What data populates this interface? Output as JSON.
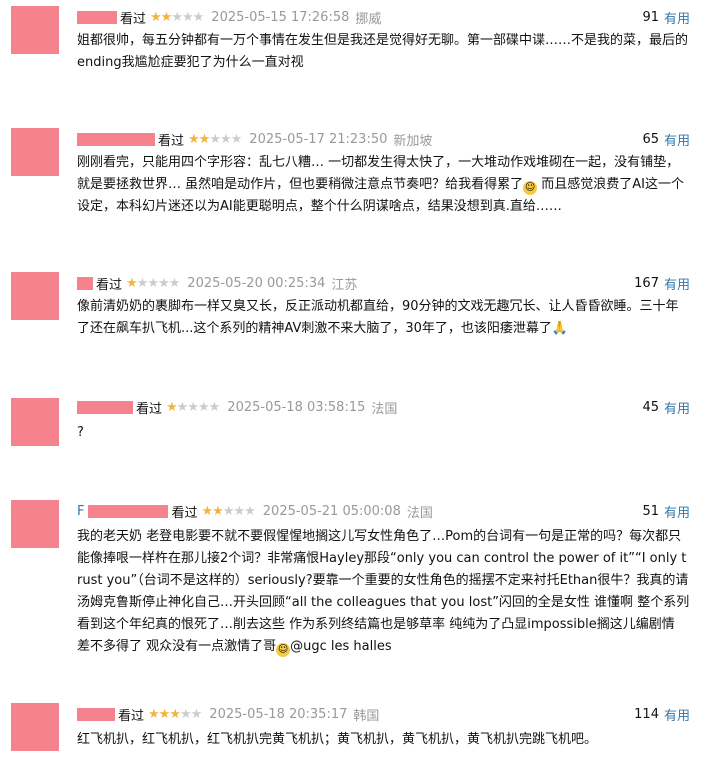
{
  "reviews": [
    {
      "seen_label": "看过",
      "stars": 2,
      "time": "2025-05-15 17:26:58",
      "location": "挪威",
      "useful_count": "91",
      "useful_label": "有用",
      "content": "姐都很帅，每五分钟都有一万个事情在发生但是我还是觉得好无聊。第一部碟中谍……不是我的菜，最后的ending我尴尬症要犯了为什么一直对视"
    },
    {
      "seen_label": "看过",
      "stars": 2,
      "time": "2025-05-17 21:23:50",
      "location": "新加坡",
      "useful_count": "65",
      "useful_label": "有用",
      "content": "刚刚看完，只能用四个字形容：乱七八糟… 一切都发生得太快了，一大堆动作戏堆砌在一起，没有铺垫，就是要拯救世界… 虽然咱是动作片，但也要稍微注意点节奏吧？给我看得累了",
      "content_after": " 而且感觉浪费了AI这一个设定，本科幻片迷还以为AI能更聪明点，整个什么阴谋啥点，结果没想到真.直给……"
    },
    {
      "seen_label": "看过",
      "stars": 1,
      "time": "2025-05-20 00:25:34",
      "location": "江苏",
      "useful_count": "167",
      "useful_label": "有用",
      "content": "像前清奶奶的裹脚布一样又臭又长，反正派动机都直给，90分钟的文戏无趣冗长、让人昏昏欲睡。三十年了还在飙车扒飞机...这个系列的精神AV刺激不来大脑了，30年了，也该阳痿泄幕了",
      "emoji_end": "🙏"
    },
    {
      "seen_label": "看过",
      "stars": 1,
      "time": "2025-05-18 03:58:15",
      "location": "法国",
      "useful_count": "45",
      "useful_label": "有用",
      "content": "?"
    },
    {
      "name_prefix": "F",
      "seen_label": "看过",
      "stars": 2,
      "time": "2025-05-21 05:00:08",
      "location": "法国",
      "useful_count": "51",
      "useful_label": "有用",
      "content": "我的老天奶 老登电影要不就不要假惺惺地搁这儿写女性角色了…Pom的台词有一句是正常的吗？每次都只能像捧哏一样杵在那儿接2个词？非常痛恨Hayley那段“only you can control the power of it”“I only trust you”（台词不是这样的）seriously?要靠一个重要的女性角色的摇摆不定来衬托Ethan很牛？我真的请汤姆克鲁斯停止神化自己…开头回顾“all the colleagues that you lost”闪回的全是女性 谁懂啊 整个系列看到这个年纪真的恨死了…削去这些 作为系列终结篇也是够草率 纯纯为了凸显impossible搁这儿编剧情 差不多得了 观众没有一点激情了哥",
      "content_after": "@ugc les halles"
    },
    {
      "seen_label": "看过",
      "stars": 3,
      "time": "2025-05-18 20:35:17",
      "location": "韩国",
      "useful_count": "114",
      "useful_label": "有用",
      "content": "红飞机扒，红飞机扒，红飞机扒完黄飞机扒；黄飞机扒，黄飞机扒，黄飞机扒完跳飞机吧。"
    }
  ]
}
